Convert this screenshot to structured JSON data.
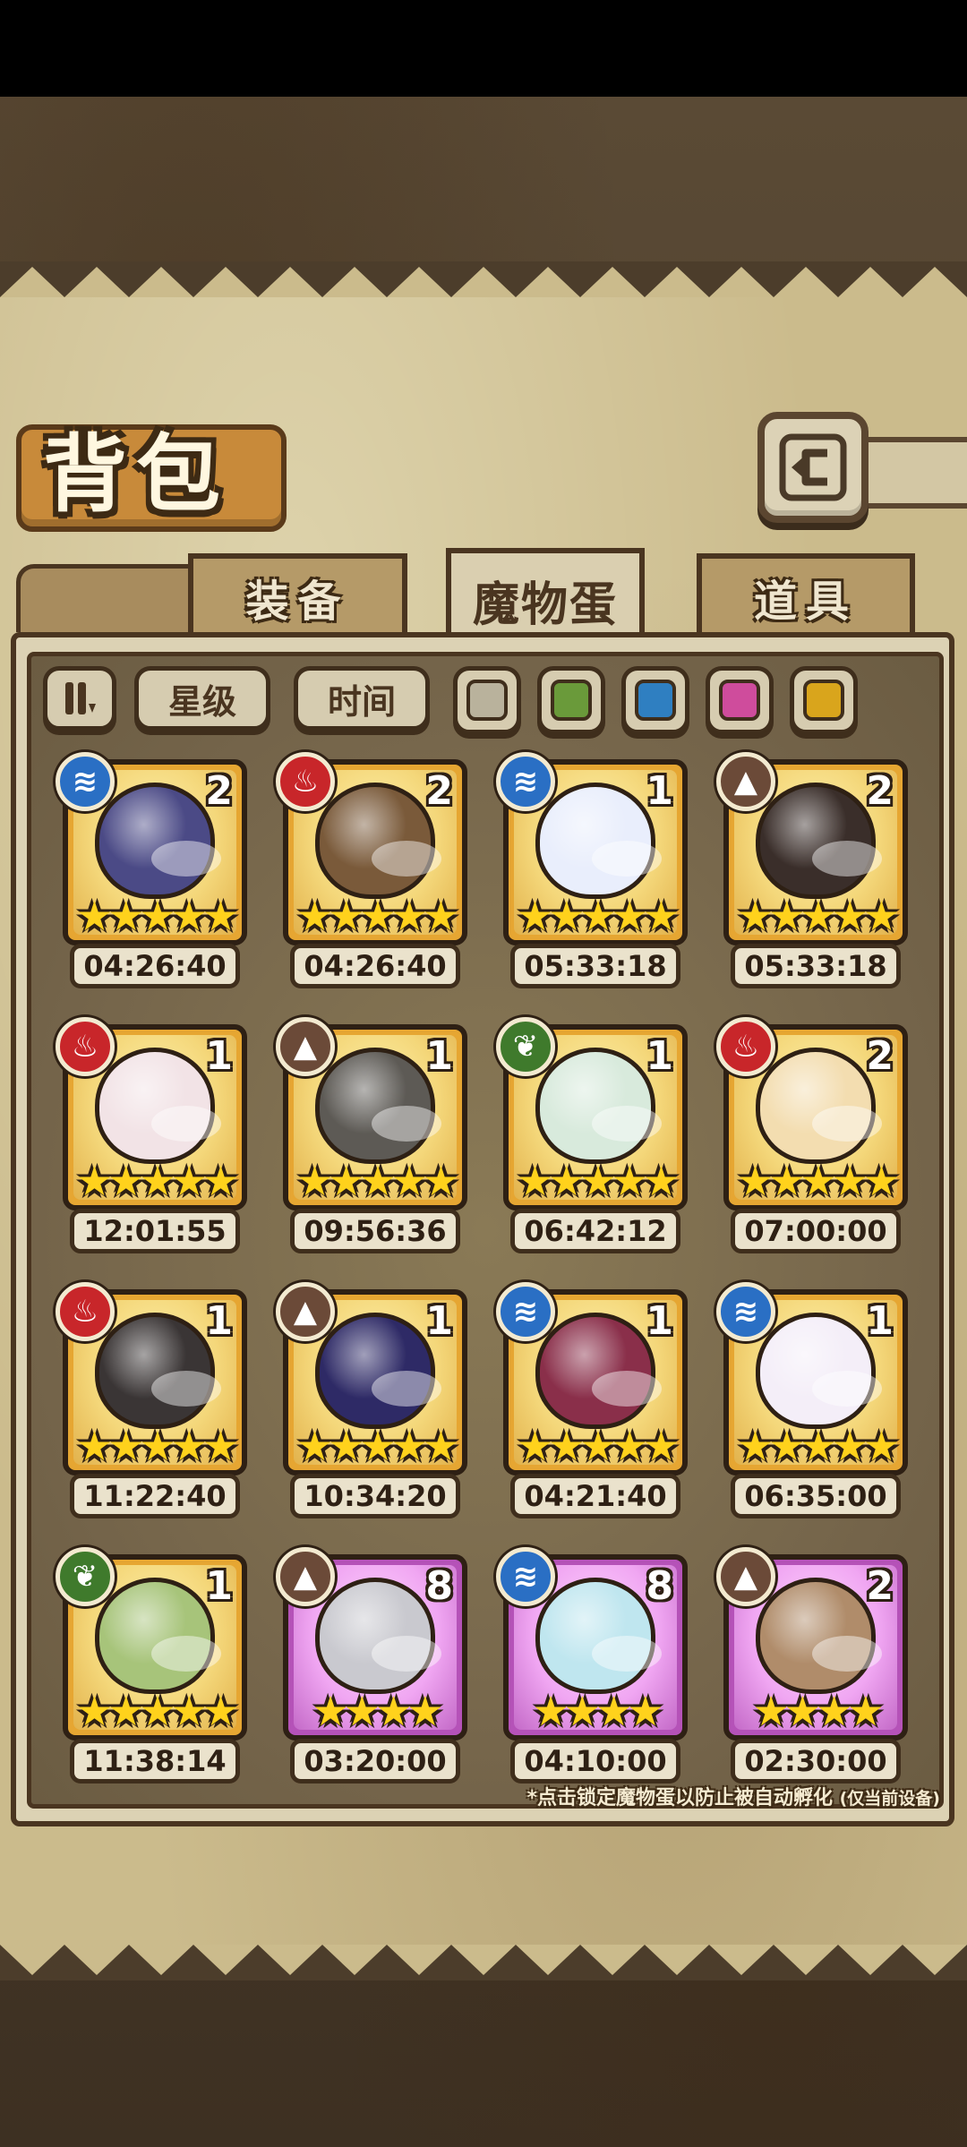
{
  "title": "背包",
  "tabs": [
    {
      "label": "装备",
      "active": false
    },
    {
      "label": "魔物蛋",
      "active": true
    },
    {
      "label": "道具",
      "active": false
    }
  ],
  "filters": {
    "sort_icon": "pause-sort-icon",
    "star_label": "星级",
    "time_label": "时间",
    "swatches": [
      {
        "name": "gray",
        "color": "#b9b29c"
      },
      {
        "name": "green",
        "color": "#6a9a3a"
      },
      {
        "name": "blue",
        "color": "#2f7fc1"
      },
      {
        "name": "pink",
        "color": "#cf4c9c"
      },
      {
        "name": "yellow",
        "color": "#d9a51c"
      }
    ]
  },
  "elements": {
    "water": {
      "icon": "water-wave-icon",
      "color": "#2a6fc4",
      "glyph": "≋"
    },
    "fire": {
      "icon": "fire-icon",
      "color": "#c8262a",
      "glyph": "♨"
    },
    "earth": {
      "icon": "mountain-icon",
      "color": "#6b4a38",
      "glyph": "▲"
    },
    "nature": {
      "icon": "leaf-icon",
      "color": "#3f7a2c",
      "glyph": "❦"
    }
  },
  "eggs": [
    {
      "element": "water",
      "count": "2",
      "stars": "★★★★★",
      "timer": "04:26:40",
      "rarity": "gold",
      "egg_color": "#4b4a86"
    },
    {
      "element": "fire",
      "count": "2",
      "stars": "★★★★★",
      "timer": "04:26:40",
      "rarity": "gold",
      "egg_color": "#7a5a3a"
    },
    {
      "element": "water",
      "count": "1",
      "stars": "★★★★★",
      "timer": "05:33:18",
      "rarity": "gold",
      "egg_color": "#e9eefc"
    },
    {
      "element": "earth",
      "count": "2",
      "stars": "★★★★★",
      "timer": "05:33:18",
      "rarity": "gold",
      "egg_color": "#3a2e2a"
    },
    {
      "element": "fire",
      "count": "1",
      "stars": "★★★★★",
      "timer": "12:01:55",
      "rarity": "gold",
      "egg_color": "#f2e3e6"
    },
    {
      "element": "earth",
      "count": "1",
      "stars": "★★★★★",
      "timer": "09:56:36",
      "rarity": "gold",
      "egg_color": "#5d5a55"
    },
    {
      "element": "nature",
      "count": "1",
      "stars": "★★★★★",
      "timer": "06:42:12",
      "rarity": "gold",
      "egg_color": "#d8eadc"
    },
    {
      "element": "fire",
      "count": "2",
      "stars": "★★★★★",
      "timer": "07:00:00",
      "rarity": "gold",
      "egg_color": "#f3ddb0"
    },
    {
      "element": "fire",
      "count": "1",
      "stars": "★★★★★",
      "timer": "11:22:40",
      "rarity": "gold",
      "egg_color": "#3a3535"
    },
    {
      "element": "earth",
      "count": "1",
      "stars": "★★★★★",
      "timer": "10:34:20",
      "rarity": "gold",
      "egg_color": "#2e2a66"
    },
    {
      "element": "water",
      "count": "1",
      "stars": "★★★★★",
      "timer": "04:21:40",
      "rarity": "gold",
      "egg_color": "#8a2f4a"
    },
    {
      "element": "water",
      "count": "1",
      "stars": "★★★★★",
      "timer": "06:35:00",
      "rarity": "gold",
      "egg_color": "#f4eef8"
    },
    {
      "element": "nature",
      "count": "1",
      "stars": "★★★★★",
      "timer": "11:38:14",
      "rarity": "gold",
      "egg_color": "#a7c47a"
    },
    {
      "element": "earth",
      "count": "8",
      "stars": "★★★★",
      "timer": "03:20:00",
      "rarity": "purple",
      "egg_color": "#c9c9cf"
    },
    {
      "element": "water",
      "count": "8",
      "stars": "★★★★",
      "timer": "04:10:00",
      "rarity": "purple",
      "egg_color": "#bfe6ef"
    },
    {
      "element": "earth",
      "count": "2",
      "stars": "★★★★",
      "timer": "02:30:00",
      "rarity": "purple",
      "egg_color": "#b08c6a"
    }
  ],
  "hint_main": "*点击锁定魔物蛋以防止被自动孵化",
  "hint_note": "(仅当前设备)"
}
